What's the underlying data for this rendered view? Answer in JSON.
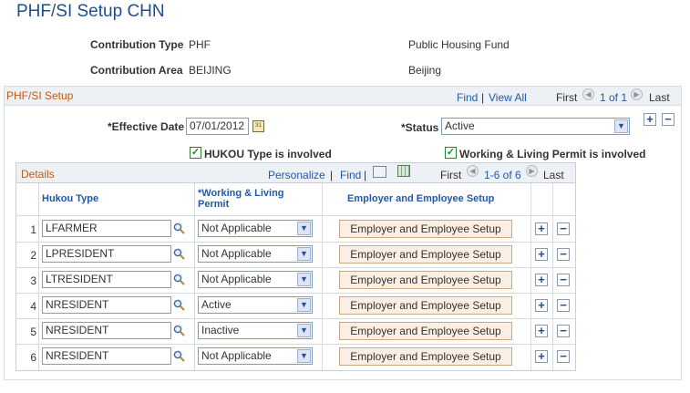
{
  "page_title": "PHF/SI Setup CHN",
  "contribution_type": {
    "label": "Contribution Type",
    "code": "PHF",
    "description": "Public Housing Fund"
  },
  "contribution_area": {
    "label": "Contribution Area",
    "code": "BEIJING",
    "description": "Beijing"
  },
  "section": {
    "title": "PHF/SI Setup",
    "find": "Find",
    "view_all": "View All",
    "first": "First",
    "count": "1 of 1",
    "last": "Last"
  },
  "effective_date": {
    "label": "*Effective Date",
    "value": "07/01/2012"
  },
  "status": {
    "label": "*Status",
    "value": "Active"
  },
  "hukou_check": {
    "label": "HUKOU Type is involved",
    "checked": true
  },
  "permit_check": {
    "label": "Working & Living Permit is involved",
    "checked": true
  },
  "details": {
    "title": "Details",
    "personalize": "Personalize",
    "find": "Find",
    "first": "First",
    "count": "1-6 of 6",
    "last": "Last",
    "columns": {
      "hukou_type": "Hukou Type",
      "permit_line1": "*Working & Living",
      "permit_line2": "Permit",
      "setup": "Employer and Employee Setup"
    },
    "rows": [
      {
        "num": "1",
        "hukou": "LFARMER",
        "permit": "Not Applicable",
        "button": "Employer and Employee Setup"
      },
      {
        "num": "2",
        "hukou": "LPRESIDENT",
        "permit": "Not Applicable",
        "button": "Employer and Employee Setup"
      },
      {
        "num": "3",
        "hukou": "LTRESIDENT",
        "permit": "Not Applicable",
        "button": "Employer and Employee Setup"
      },
      {
        "num": "4",
        "hukou": "NRESIDENT",
        "permit": "Active",
        "button": "Employer and Employee Setup"
      },
      {
        "num": "5",
        "hukou": "NRESIDENT",
        "permit": "Inactive",
        "button": "Employer and Employee Setup"
      },
      {
        "num": "6",
        "hukou": "NRESIDENT",
        "permit": "Not Applicable",
        "button": "Employer and Employee Setup"
      }
    ]
  },
  "icons": {
    "calendar": "calendar-icon",
    "lookup": "magnifier-icon",
    "add": "plus-icon",
    "delete": "minus-icon"
  }
}
